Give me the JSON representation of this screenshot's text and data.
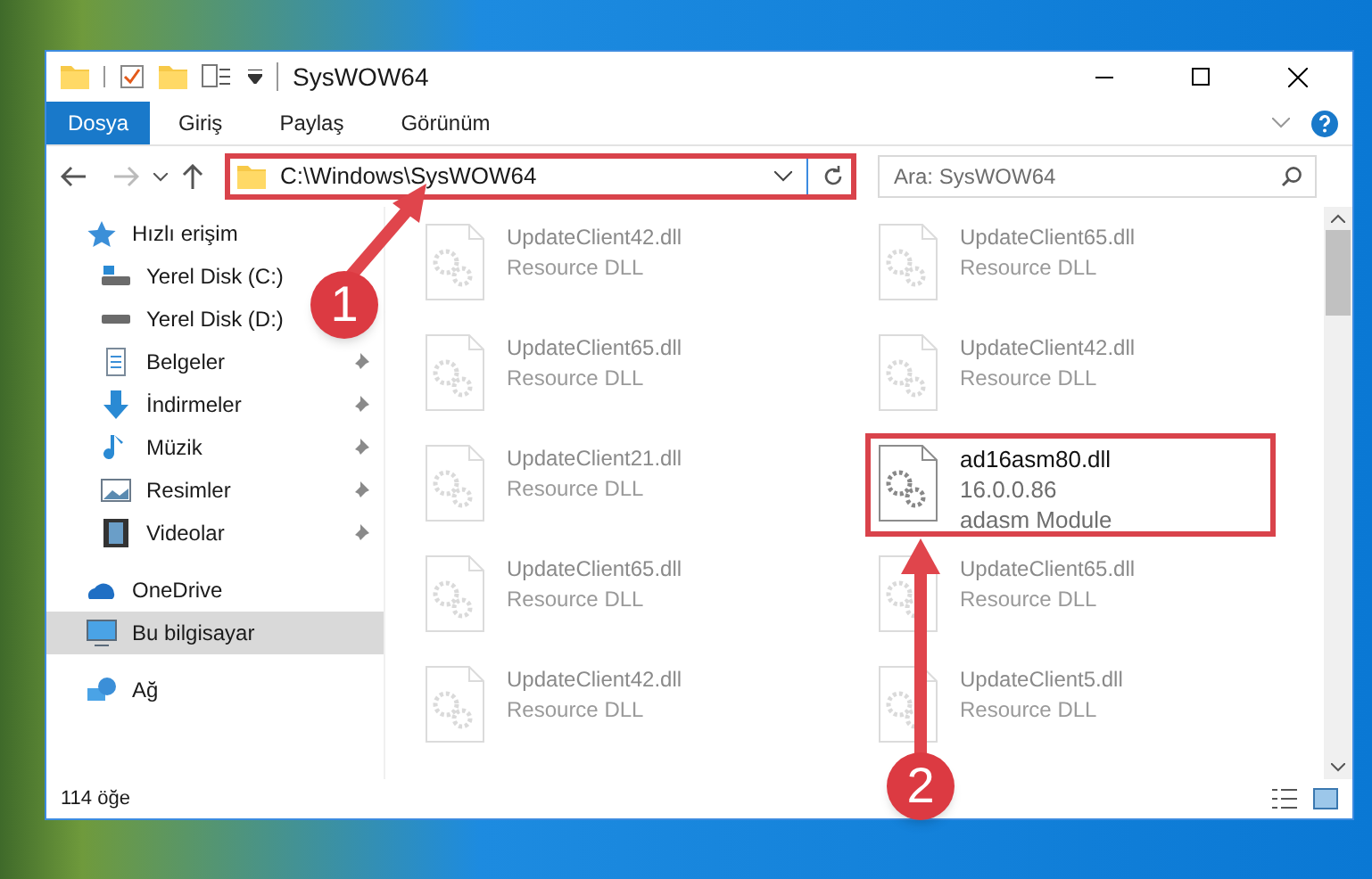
{
  "window": {
    "title": "SysWOW64"
  },
  "ribbon_tabs": [
    {
      "label": "Dosya",
      "selected": true
    },
    {
      "label": "Giriş",
      "selected": false
    },
    {
      "label": "Paylaş",
      "selected": false
    },
    {
      "label": "Görünüm",
      "selected": false
    }
  ],
  "address_bar": {
    "value": "C:\\Windows\\SysWOW64",
    "highlighted": true
  },
  "search": {
    "placeholder": "Ara: SysWOW64"
  },
  "sidebar": {
    "items": [
      {
        "label": "Hızlı erişim",
        "kind": "group",
        "pinned": false,
        "selected": false
      },
      {
        "label": "Yerel Disk (C:)",
        "kind": "item",
        "pinned": false,
        "selected": false
      },
      {
        "label": "Yerel Disk (D:)",
        "kind": "item",
        "pinned": false,
        "selected": false
      },
      {
        "label": "Belgeler",
        "kind": "item",
        "pinned": true,
        "selected": false
      },
      {
        "label": "İndirmeler",
        "kind": "item",
        "pinned": true,
        "selected": false
      },
      {
        "label": "Müzik",
        "kind": "item",
        "pinned": true,
        "selected": false
      },
      {
        "label": "Resimler",
        "kind": "item",
        "pinned": true,
        "selected": false
      },
      {
        "label": "Videolar",
        "kind": "item",
        "pinned": true,
        "selected": false
      },
      {
        "label": "OneDrive",
        "kind": "group",
        "pinned": false,
        "selected": false
      },
      {
        "label": "Bu bilgisayar",
        "kind": "group",
        "pinned": false,
        "selected": true
      },
      {
        "label": "Ağ",
        "kind": "group",
        "pinned": false,
        "selected": false
      }
    ]
  },
  "files": [
    {
      "name": "UpdateClient42.dll",
      "details": [
        "Resource DLL"
      ],
      "blurred": true,
      "highlighted": false
    },
    {
      "name": "UpdateClient65.dll",
      "details": [
        "Resource DLL"
      ],
      "blurred": true,
      "highlighted": false
    },
    {
      "name": "UpdateClient65.dll",
      "details": [
        "Resource DLL"
      ],
      "blurred": true,
      "highlighted": false
    },
    {
      "name": "UpdateClient42.dll",
      "details": [
        "Resource DLL"
      ],
      "blurred": true,
      "highlighted": false
    },
    {
      "name": "UpdateClient21.dll",
      "details": [
        "Resource DLL"
      ],
      "blurred": true,
      "highlighted": false
    },
    {
      "name": "ad16asm80.dll",
      "details": [
        "16.0.0.86",
        "adasm Module"
      ],
      "blurred": false,
      "highlighted": true
    },
    {
      "name": "UpdateClient65.dll",
      "details": [
        "Resource DLL"
      ],
      "blurred": true,
      "highlighted": false
    },
    {
      "name": "UpdateClient65.dll",
      "details": [
        "Resource DLL"
      ],
      "blurred": true,
      "highlighted": false
    },
    {
      "name": "UpdateClient42.dll",
      "details": [
        "Resource DLL"
      ],
      "blurred": true,
      "highlighted": false
    },
    {
      "name": "UpdateClient5.dll",
      "details": [
        "Resource DLL"
      ],
      "blurred": true,
      "highlighted": false
    }
  ],
  "status_bar": {
    "count": "114 öğe"
  },
  "callouts": [
    {
      "number": "1"
    },
    {
      "number": "2"
    }
  ]
}
